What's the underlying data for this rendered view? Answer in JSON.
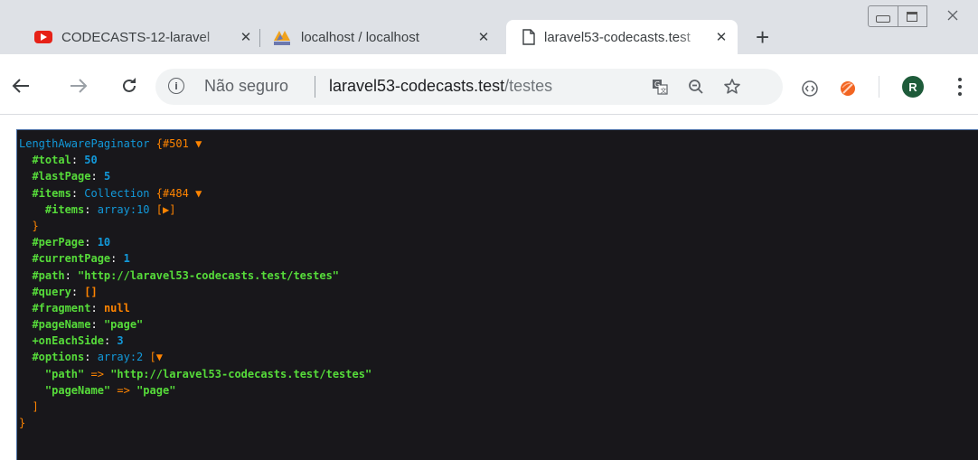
{
  "browser": {
    "tabs": [
      {
        "title": "CODECASTS-12-laravel",
        "favicon": "youtube-icon",
        "close": "✕"
      },
      {
        "title": "localhost / localhost",
        "favicon": "phpmyadmin-icon",
        "close": "✕"
      },
      {
        "title": "laravel53-codecasts.test",
        "favicon": "page-icon",
        "close": "✕",
        "active": true
      }
    ],
    "new_tab": "+",
    "address": {
      "security_label": "Não seguro",
      "host": "laravel53-codecasts.test",
      "path": "/testes"
    },
    "profile_initial": "R",
    "colors": {
      "tabstrip": "#dee1e6",
      "avatar": "#1e5b3a",
      "dump_bg": "#18171b"
    }
  },
  "dump": {
    "root_class": "LengthAwarePaginator",
    "root_id": "{#501 ▼",
    "total_key": "#total",
    "total_val": "50",
    "lastpage_key": "#lastPage",
    "lastpage_val": "5",
    "items_key": "#items",
    "items_class": "Collection",
    "items_id": "{#484 ▼",
    "inner_items_key": "#items",
    "inner_items_val": "array:10",
    "inner_items_toggle": "[▶]",
    "close_items": "}",
    "perpage_key": "#perPage",
    "perpage_val": "10",
    "currentpage_key": "#currentPage",
    "currentpage_val": "1",
    "path_key": "#path",
    "path_val": "\"http://laravel53-codecasts.test/testes\"",
    "query_key": "#query",
    "query_val": "[]",
    "fragment_key": "#fragment",
    "fragment_val": "null",
    "pagename_key": "#pageName",
    "pagename_val": "\"page\"",
    "oneachside_key": "+onEachSide",
    "oneachside_val": "3",
    "options_key": "#options",
    "options_val": "array:2",
    "options_toggle": "[▼",
    "opt_path_key": "\"path\"",
    "opt_arrow": "=>",
    "opt_path_val": "\"http://laravel53-codecasts.test/testes\"",
    "opt_pagename_key": "\"pageName\"",
    "opt_pagename_val": "\"page\"",
    "close_options": "]",
    "close_root": "}"
  }
}
